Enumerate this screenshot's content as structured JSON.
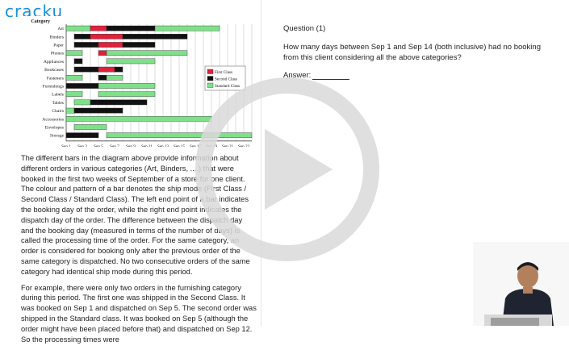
{
  "brand": {
    "logo_text": "cracku"
  },
  "chart_data": {
    "type": "gantt",
    "categories": [
      "Art",
      "Binders",
      "Paper",
      "Phones",
      "Appliances",
      "Bookcases",
      "Fasteners",
      "Furnishings",
      "Labels",
      "Tables",
      "Chairs",
      "Accessories",
      "Envelopes",
      "Storage"
    ],
    "category_header": "Category",
    "x_ticks": [
      "Sep 1",
      "Sep 3",
      "Sep 5",
      "Sep 7",
      "Sep 9",
      "Sep 11",
      "Sep 13",
      "Sep 15",
      "Sep 17",
      "Sep 19",
      "Sep 21",
      "Sep 23"
    ],
    "x_range": [
      1,
      24
    ],
    "legend": [
      {
        "name": "First Class",
        "color": "#e0203c"
      },
      {
        "name": "Second Class",
        "color": "#111111"
      },
      {
        "name": "Standard Class",
        "color": "#7fe08a"
      }
    ],
    "legend_placement": "right",
    "grid": "vertical",
    "orders": [
      {
        "category": "Art",
        "start": 1,
        "end": 4,
        "ship": "Standard Class"
      },
      {
        "category": "Art",
        "start": 4,
        "end": 6,
        "ship": "First Class"
      },
      {
        "category": "Art",
        "start": 6,
        "end": 12,
        "ship": "Second Class"
      },
      {
        "category": "Art",
        "start": 12,
        "end": 20,
        "ship": "Standard Class"
      },
      {
        "category": "Binders",
        "start": 2,
        "end": 4,
        "ship": "Second Class"
      },
      {
        "category": "Binders",
        "start": 4,
        "end": 8,
        "ship": "First Class"
      },
      {
        "category": "Binders",
        "start": 8,
        "end": 16,
        "ship": "Second Class"
      },
      {
        "category": "Paper",
        "start": 2,
        "end": 5,
        "ship": "Second Class"
      },
      {
        "category": "Paper",
        "start": 5,
        "end": 8,
        "ship": "First Class"
      },
      {
        "category": "Paper",
        "start": 8,
        "end": 12,
        "ship": "Second Class"
      },
      {
        "category": "Phones",
        "start": 1,
        "end": 3,
        "ship": "Standard Class"
      },
      {
        "category": "Phones",
        "start": 5,
        "end": 6,
        "ship": "First Class"
      },
      {
        "category": "Phones",
        "start": 6,
        "end": 16,
        "ship": "Standard Class"
      },
      {
        "category": "Appliances",
        "start": 2,
        "end": 3,
        "ship": "Second Class"
      },
      {
        "category": "Appliances",
        "start": 6,
        "end": 12,
        "ship": "Standard Class"
      },
      {
        "category": "Bookcases",
        "start": 2,
        "end": 5,
        "ship": "Second Class"
      },
      {
        "category": "Bookcases",
        "start": 5,
        "end": 7,
        "ship": "First Class"
      },
      {
        "category": "Bookcases",
        "start": 7,
        "end": 8,
        "ship": "Second Class"
      },
      {
        "category": "Fasteners",
        "start": 1,
        "end": 3,
        "ship": "Standard Class"
      },
      {
        "category": "Fasteners",
        "start": 5,
        "end": 6,
        "ship": "Second Class"
      },
      {
        "category": "Fasteners",
        "start": 6,
        "end": 8,
        "ship": "Standard Class"
      },
      {
        "category": "Furnishings",
        "start": 1,
        "end": 5,
        "ship": "Second Class"
      },
      {
        "category": "Furnishings",
        "start": 5,
        "end": 12,
        "ship": "Standard Class"
      },
      {
        "category": "Labels",
        "start": 1,
        "end": 3,
        "ship": "Standard Class"
      },
      {
        "category": "Labels",
        "start": 5,
        "end": 12,
        "ship": "Standard Class"
      },
      {
        "category": "Tables",
        "start": 2,
        "end": 4,
        "ship": "Standard Class"
      },
      {
        "category": "Tables",
        "start": 4,
        "end": 11,
        "ship": "Second Class"
      },
      {
        "category": "Chairs",
        "start": 1,
        "end": 2,
        "ship": "Standard Class"
      },
      {
        "category": "Chairs",
        "start": 2,
        "end": 8,
        "ship": "Second Class"
      },
      {
        "category": "Accessories",
        "start": 1,
        "end": 19,
        "ship": "Standard Class"
      },
      {
        "category": "Envelopes",
        "start": 2,
        "end": 6,
        "ship": "Standard Class"
      },
      {
        "category": "Storage",
        "start": 1,
        "end": 5,
        "ship": "Second Class"
      },
      {
        "category": "Storage",
        "start": 6,
        "end": 24,
        "ship": "Standard Class"
      }
    ]
  },
  "passage": {
    "paragraph1": "The different bars in the diagram above provide information about different orders in various categories (Art, Binders, ....) that were booked in the first two weeks of September of a store for one client. The colour and pattern of a bar denotes the ship mode (First Class / Second Class / Standard Class). The left end point of a bar indicates the booking day of the order, while the right end point indicates the dispatch day of the order. The difference between the dispatch day and the booking day (measured in terms of the number of days) is called the processing time of the order. For the same category, an order is considered for booking only after the previous order of the same category is dispatched. No two consecutive orders of the same category had identical ship mode during this period.",
    "paragraph2": "For example, there were only two orders in the furnishing category during this period. The first one was shipped in the Second Class. It was booked on Sep 1 and dispatched on Sep 5. The second order was shipped in the Standard class. It was booked on Sep 5 (although the order might have been placed before that) and dispatched on Sep 12. So the processing times were"
  },
  "question": {
    "title": "Question (1)",
    "text": "How many days between Sep 1 and Sep 14 (both inclusive) had no booking from this client considering all the above categories?",
    "answer_label": "Answer:"
  },
  "overlay": {
    "play_icon": "play-icon",
    "color": "#d9d9d9"
  }
}
